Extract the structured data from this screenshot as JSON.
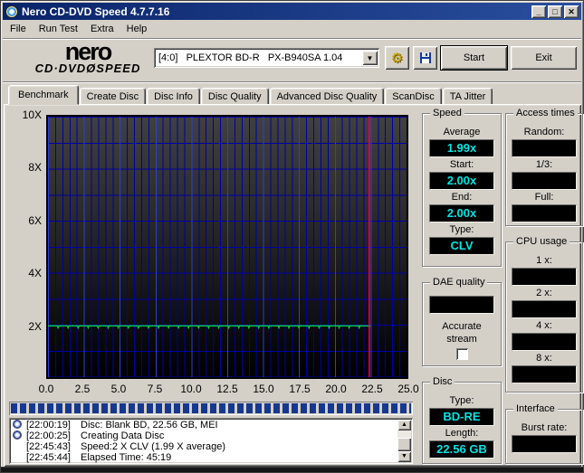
{
  "window": {
    "title": "Nero CD-DVD Speed 4.7.7.16",
    "minimize": "_",
    "maximize": "□",
    "close": "✕"
  },
  "menu": {
    "items": [
      "File",
      "Run Test",
      "Extra",
      "Help"
    ]
  },
  "header": {
    "logo_top": "nero",
    "logo_bottom": "CD·DVDØSPEED",
    "drive_selected": "[4:0]   PLEXTOR BD-R   PX-B940SA 1.04",
    "combo_arrow": "▼",
    "start_label": "Start",
    "exit_label": "Exit",
    "options_icon": "⚙",
    "save_icon": "🖫"
  },
  "tabs": [
    {
      "label": "Benchmark",
      "active": true
    },
    {
      "label": "Create Disc",
      "active": false
    },
    {
      "label": "Disc Info",
      "active": false
    },
    {
      "label": "Disc Quality",
      "active": false
    },
    {
      "label": "Advanced Disc Quality",
      "active": false
    },
    {
      "label": "ScanDisc",
      "active": false
    },
    {
      "label": "TA Jitter",
      "active": false
    }
  ],
  "chart_data": {
    "type": "line",
    "title": "",
    "xlabel": "",
    "ylabel": "",
    "xlim": [
      0,
      25
    ],
    "ylim": [
      0,
      10
    ],
    "x_ticks": [
      0.0,
      2.5,
      5.0,
      7.5,
      10.0,
      12.5,
      15.0,
      17.5,
      20.0,
      22.5,
      25.0
    ],
    "y_ticks": [
      {
        "value": 10,
        "label": "10X"
      },
      {
        "value": 8,
        "label": "8X"
      },
      {
        "value": 6,
        "label": "6X"
      },
      {
        "value": 4,
        "label": "4X"
      },
      {
        "value": 2,
        "label": "2X"
      }
    ],
    "grid": {
      "x_minor_step": 0.5,
      "x_major_step": 2.5,
      "y_step": 1,
      "on": true
    },
    "legend": "none",
    "series": [
      {
        "name": "read-speed",
        "color": "#00d040",
        "baseline": 1.97,
        "dip": 1.9,
        "dip_interval": 0.7,
        "x_start": 0,
        "x_end": 22.4,
        "average": 1.99
      }
    ],
    "cursor_x": 22.4,
    "cursor_color": "#e8004c"
  },
  "panels": {
    "speed": {
      "title": "Speed",
      "fields": [
        {
          "label": "Average",
          "value": "1.99x"
        },
        {
          "label": "Start:",
          "value": "2.00x"
        },
        {
          "label": "End:",
          "value": "2.00x"
        },
        {
          "label": "Type:",
          "value": "CLV"
        }
      ]
    },
    "access_times": {
      "title": "Access times",
      "fields": [
        {
          "label": "Random:",
          "value": ""
        },
        {
          "label": "1/3:",
          "value": ""
        },
        {
          "label": "Full:",
          "value": ""
        }
      ]
    },
    "cpu_usage": {
      "title": "CPU usage",
      "fields": [
        {
          "label": "1 x:",
          "value": ""
        },
        {
          "label": "2 x:",
          "value": ""
        },
        {
          "label": "4 x:",
          "value": ""
        },
        {
          "label": "8 x:",
          "value": ""
        }
      ]
    },
    "dae_quality": {
      "title": "DAE quality",
      "value": "",
      "checkbox_label_line1": "Accurate",
      "checkbox_label_line2": "stream",
      "checkbox_checked": false
    },
    "disc": {
      "title": "Disc",
      "fields": [
        {
          "label": "Type:",
          "value": "BD-RE"
        },
        {
          "label": "Length:",
          "value": "22.56 GB"
        }
      ]
    },
    "interface": {
      "title": "Interface",
      "fields": [
        {
          "label": "Burst rate:",
          "value": ""
        }
      ]
    }
  },
  "progress": {
    "percent": 100
  },
  "log": {
    "entries": [
      {
        "icon": true,
        "time": "[22:00:19]",
        "text": "Disc: Blank BD, 22.56 GB, MEI"
      },
      {
        "icon": true,
        "time": "[22:00:25]",
        "text": "Creating Data Disc"
      },
      {
        "icon": false,
        "time": "[22:45:43]",
        "text": "Speed:2 X CLV (1.99 X average)"
      },
      {
        "icon": false,
        "time": "[22:45:44]",
        "text": "Elapsed Time: 45:19"
      }
    ],
    "scroll_up": "▲",
    "scroll_down": "▼"
  },
  "colors": {
    "titlebar": "#0a246a",
    "display_text": "#00e5e5",
    "display_bg": "#000000",
    "chart_green": "#00d040",
    "chart_cursor": "#e8004c",
    "grid_blue": "#0000a4",
    "grid_blue_bright": "#2e3ed8",
    "progress_block": "#16388e"
  }
}
